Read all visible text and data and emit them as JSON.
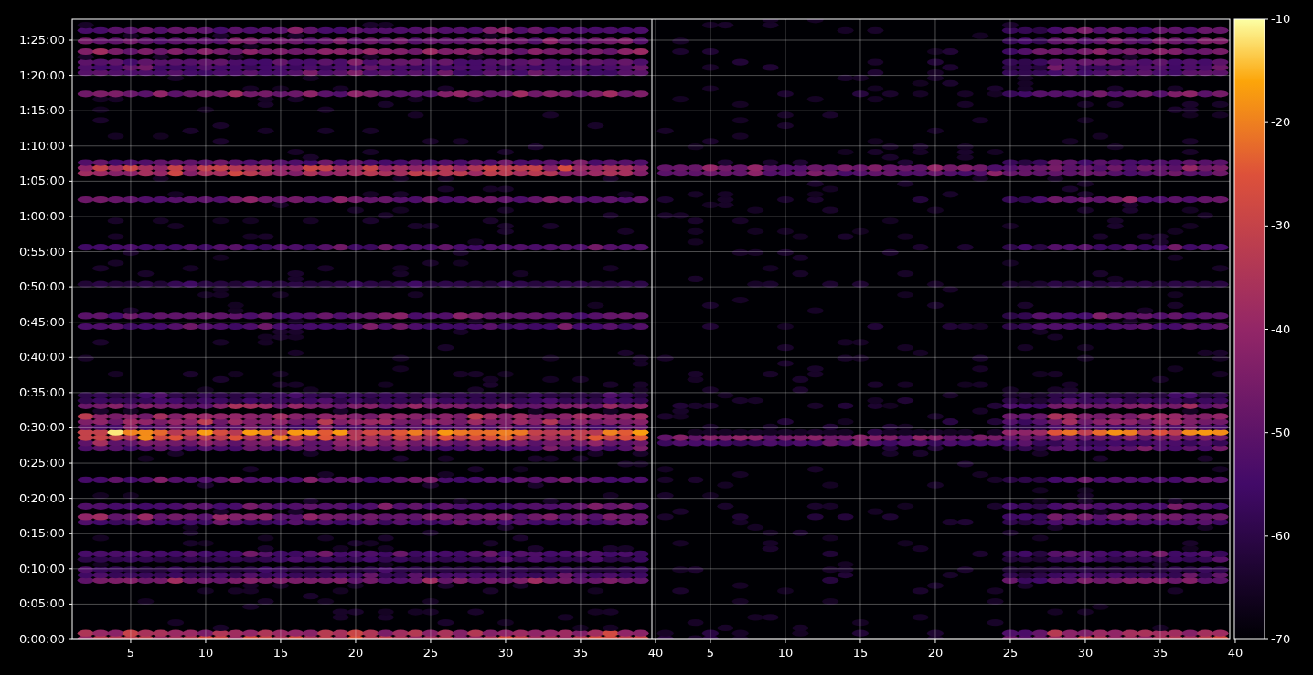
{
  "chart": {
    "y_ticks": [
      "1:25:00",
      "1:20:00",
      "1:15:00",
      "1:10:00",
      "1:05:00",
      "1:00:00",
      "0:55:00",
      "0:50:00",
      "0:45:00",
      "0:40:00",
      "0:35:00",
      "0:30:00",
      "0:25:00",
      "0:20:00",
      "0:15:00",
      "0:10:00",
      "0:05:00",
      "0:00:00"
    ],
    "panels": [
      {
        "x_ticks": [
          "5",
          "10",
          "15",
          "20",
          "25",
          "30",
          "35",
          "40"
        ]
      },
      {
        "x_ticks": [
          "5",
          "10",
          "15",
          "20",
          "25",
          "30",
          "35",
          "40"
        ]
      }
    ],
    "colorbar": {
      "ticks": [
        "-10",
        "-20",
        "-30",
        "-40",
        "-50",
        "-60",
        "-70"
      ]
    }
  }
}
